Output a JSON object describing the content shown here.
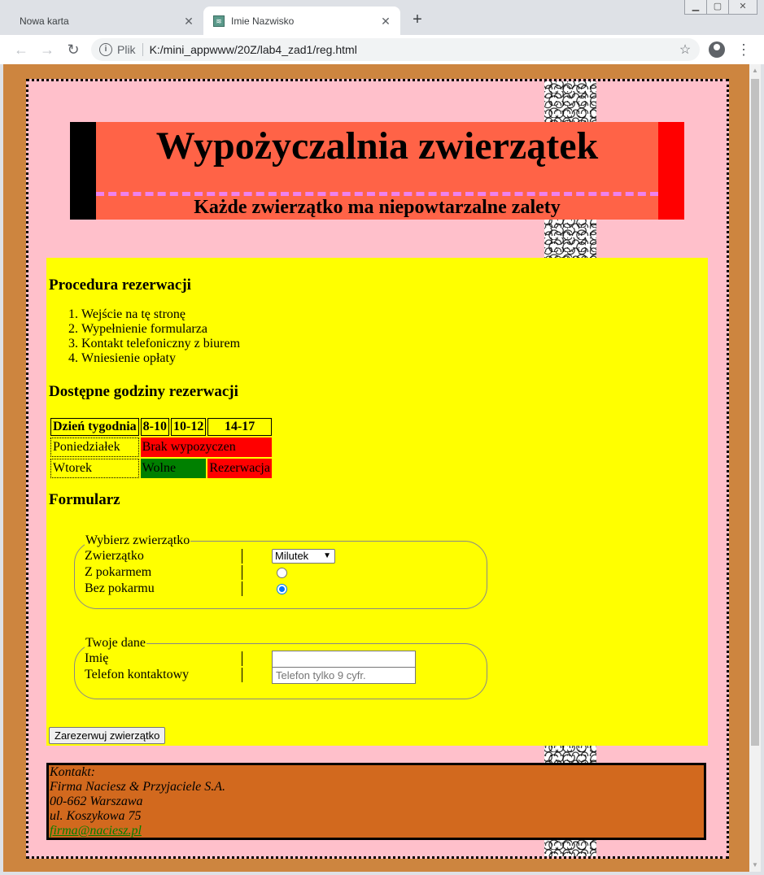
{
  "browser": {
    "tabs": [
      {
        "title": "Nowa karta",
        "active": false
      },
      {
        "title": "Imie Nazwisko",
        "active": true
      }
    ],
    "new_tab_icon": "plus-icon",
    "address": {
      "scheme": "Plik",
      "url": "K:/mini_appwww/20Z/lab4_zad1/reg.html"
    },
    "window_controls": [
      "minimize-icon",
      "maximize-icon",
      "close-icon"
    ]
  },
  "header": {
    "title": "Wypożyczalnia zwierzątek",
    "subtitle": "Każde zwierzątko ma niepowtarzalne zalety"
  },
  "procedure": {
    "heading": "Procedura rezerwacji",
    "steps": [
      "Wejście na tę stronę",
      "Wypełnienie formularza",
      "Kontakt telefoniczny z biurem",
      "Wniesienie opłaty"
    ]
  },
  "hours": {
    "heading": "Dostępne godziny rezerwacji",
    "columns": [
      "Dzień tygodnia",
      "8-10",
      "10-12",
      "14-17"
    ],
    "rows": [
      {
        "day": "Poniedziałek",
        "cells": [
          {
            "text": "Brak wypozyczen",
            "span": 3,
            "color": "#ff0000"
          }
        ]
      },
      {
        "day": "Wtorek",
        "cells": [
          {
            "text": "Wolne",
            "span": 2,
            "color": "#008000"
          },
          {
            "text": "Rezerwacja",
            "span": 1,
            "color": "#ff0000"
          }
        ]
      }
    ]
  },
  "form": {
    "heading": "Formularz",
    "animal_group": {
      "legend": "Wybierz zwierzątko",
      "animal_label": "Zwierzątko",
      "animal_selected": "Milutek",
      "with_food_label": "Z pokarmem",
      "with_food_checked": false,
      "without_food_label": "Bez pokarmu",
      "without_food_checked": true
    },
    "data_group": {
      "legend": "Twoje dane",
      "name_label": "Imię",
      "name_value": "",
      "phone_label": "Telefon kontaktowy",
      "phone_placeholder": "Telefon tylko 9 cyfr."
    },
    "submit_label": "Zarezerwuj zwierzątko"
  },
  "footer": {
    "lines": [
      "Kontakt:",
      "Firma Naciesz & Przyjaciele S.A.",
      "00-662 Warszawa",
      "ul. Koszykowa 75"
    ],
    "email": "firma@naciesz.pl"
  },
  "colors": {
    "page_bg": "#ffc0cb",
    "outer_bg": "#cd853f",
    "header_bg": "#ff6347",
    "main_bg": "#ffff00",
    "footer_bg": "#d2691e"
  }
}
